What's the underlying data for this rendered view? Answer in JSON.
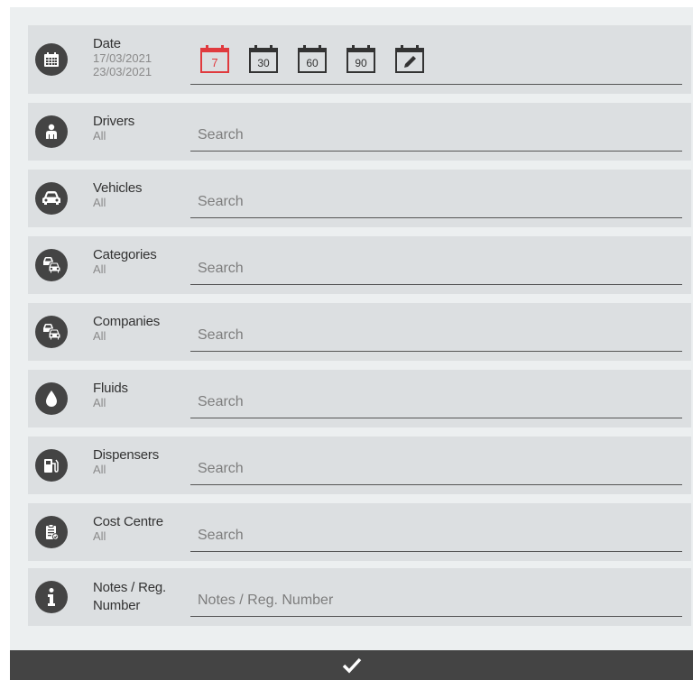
{
  "rows": [
    {
      "title": "Date",
      "sub": "17/03/2021",
      "sub2": "23/03/2021",
      "icon": "calendar-icon"
    },
    {
      "title": "Drivers",
      "sub": "All",
      "placeholder": "Search",
      "icon": "person-icon"
    },
    {
      "title": "Vehicles",
      "sub": "All",
      "placeholder": "Search",
      "icon": "car-icon"
    },
    {
      "title": "Categories",
      "sub": "All",
      "placeholder": "Search",
      "icon": "cars-icon"
    },
    {
      "title": "Companies",
      "sub": "All",
      "placeholder": "Search",
      "icon": "cars-icon"
    },
    {
      "title": "Fluids",
      "sub": "All",
      "placeholder": "Search",
      "icon": "drop-icon"
    },
    {
      "title": "Dispensers",
      "sub": "All",
      "placeholder": "Search",
      "icon": "fuel-pump-icon"
    },
    {
      "title": "Cost Centre",
      "sub": "All",
      "placeholder": "Search",
      "icon": "clipboard-check-icon"
    },
    {
      "title": "Notes / Reg. Number",
      "sub": "",
      "placeholder": "Notes / Reg. Number",
      "icon": "info-icon"
    }
  ],
  "date_presets": [
    {
      "label": "7",
      "active": true
    },
    {
      "label": "30",
      "active": false
    },
    {
      "label": "60",
      "active": false
    },
    {
      "label": "90",
      "active": false
    },
    {
      "label": "",
      "icon": "pencil-icon",
      "active": false
    }
  ],
  "footer": {
    "icon": "checkmark-icon"
  },
  "colors": {
    "accent": "#e03a3e",
    "dark": "#444444",
    "row": "#dcdfe1",
    "panel": "#eceff0"
  }
}
